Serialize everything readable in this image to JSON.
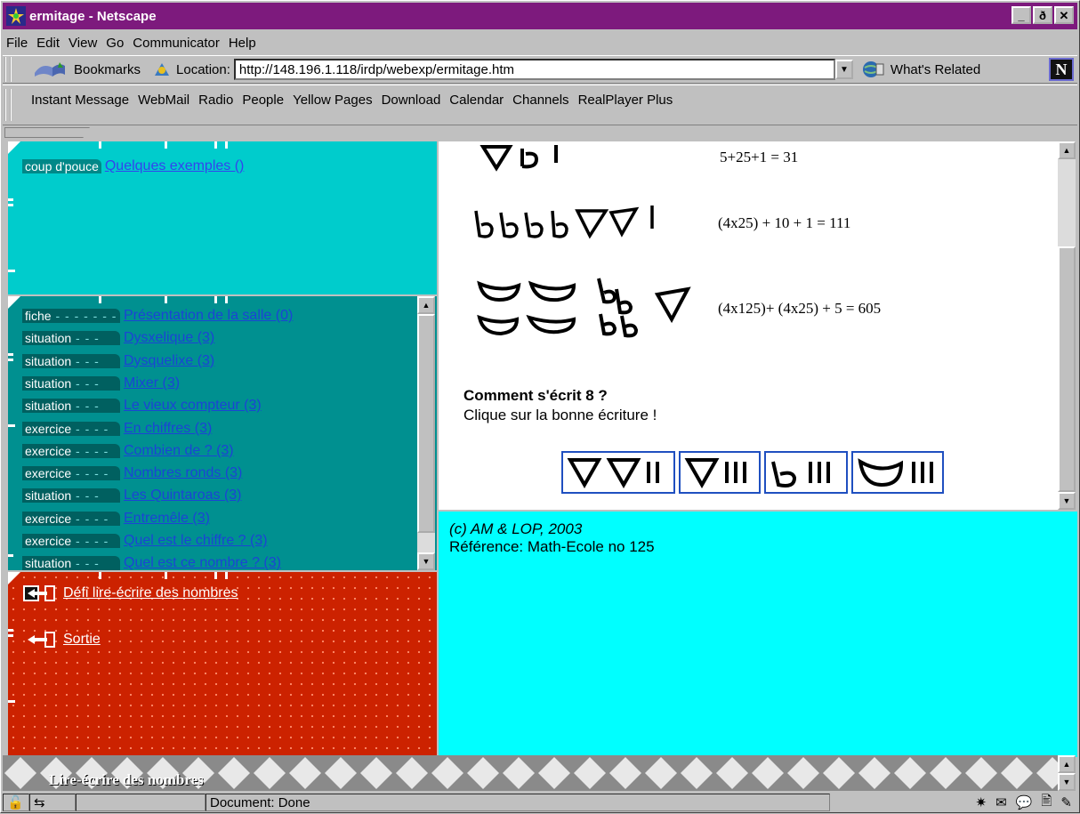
{
  "window": {
    "title": "ermitage - Netscape",
    "min": "_",
    "max": "ð",
    "close": "✕"
  },
  "menu": [
    "File",
    "Edit",
    "View",
    "Go",
    "Communicator",
    "Help"
  ],
  "nav": {
    "bookmarks": "Bookmarks",
    "location_label": "Location:",
    "url": "http://148.196.1.118/irdp/webexp/ermitage.htm",
    "whats_related": "What's Related"
  },
  "personal_toolbar": [
    "Instant Message",
    "WebMail",
    "Radio",
    "People",
    "Yellow Pages",
    "Download",
    "Calendar",
    "Channels",
    "RealPlayer Plus"
  ],
  "top_frame": {
    "tag": "coup d'pouce",
    "link": "Quelques exemples ()"
  },
  "activities": [
    {
      "tag": "fiche",
      "dots": " - - - - - - -",
      "link": "Présentation de la salle (0)"
    },
    {
      "tag": "situation",
      "dots": " - - -",
      "link": "Dysxelique (3)"
    },
    {
      "tag": "situation",
      "dots": " - - -",
      "link": "Dysquelixe (3)"
    },
    {
      "tag": "situation",
      "dots": " - - -",
      "link": "Mixer (3)"
    },
    {
      "tag": "situation",
      "dots": " - - -",
      "link": "Le vieux compteur (3)"
    },
    {
      "tag": "exercice",
      "dots": " - - - -",
      "link": "En chiffres (3)"
    },
    {
      "tag": "exercice",
      "dots": " - - - -",
      "link": "Combien de ? (3)"
    },
    {
      "tag": "exercice",
      "dots": " - - - -",
      "link": "Nombres ronds (3)"
    },
    {
      "tag": "situation",
      "dots": " - - -",
      "link": "Les Quintaroas (3)"
    },
    {
      "tag": "exercice",
      "dots": " - - - -",
      "link": "Entremêle (3)"
    },
    {
      "tag": "exercice",
      "dots": " - - - -",
      "link": "Quel est le chiffre ? (3)"
    },
    {
      "tag": "situation",
      "dots": " - - -",
      "link": "Quel est ce nombre ? (3)"
    }
  ],
  "red_frame": {
    "back_link": "Défi lire-écrire des nombres",
    "exit_link": "Sortie"
  },
  "main": {
    "eq1": "5+25+1 = 31",
    "eq2": "(4x25) + 10 + 1 = 111",
    "eq3": "(4x125)+ (4x25) + 5 = 605",
    "question": "Comment s'écrit 8 ?",
    "instruction": "Clique sur la bonne écriture !"
  },
  "credits": {
    "line1": "(c) AM & LOP, 2003",
    "line2": "Référence: Math-Ecole no 125"
  },
  "footer_title": "Lire-écrire des nombres",
  "status": {
    "text": "Document: Done"
  }
}
